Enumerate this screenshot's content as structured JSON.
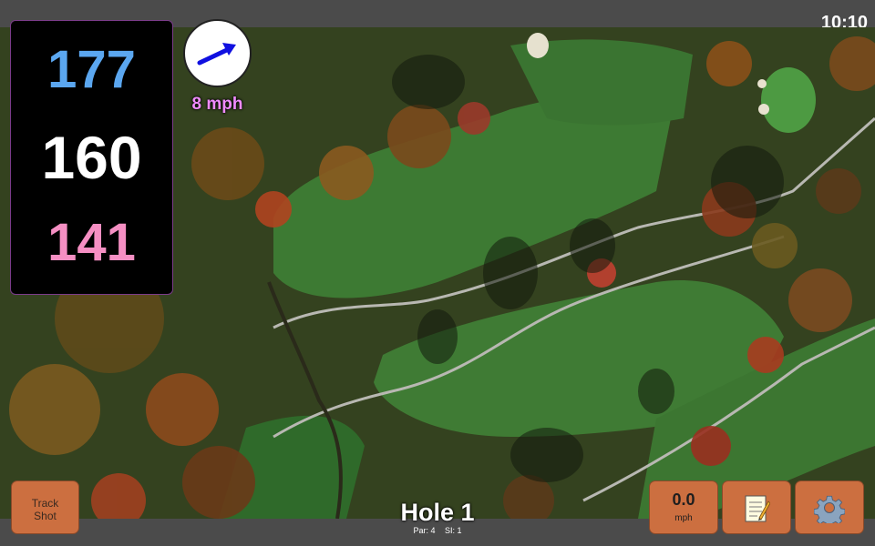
{
  "status_bar": {
    "time": "10:10"
  },
  "distances": {
    "back": "177",
    "center": "160",
    "front": "141"
  },
  "wind": {
    "speed": "8 mph",
    "arrow_icon": "wind-direction-arrow-icon",
    "color": "#1010e0"
  },
  "hole": {
    "title": "Hole 1",
    "par": "Par: 4",
    "stroke_index": "SI: 1"
  },
  "buttons": {
    "track_shot": {
      "line1": "Track",
      "line2": "Shot"
    },
    "speed": {
      "value": "0.0",
      "unit": "mph"
    },
    "notes_icon": "notepad-icon",
    "settings_icon": "gear-icon"
  },
  "colors": {
    "back_distance": "#5ba7f0",
    "center_distance": "#ffffff",
    "front_distance": "#f58fc3",
    "button_accent": "#cc6f40",
    "wind_text": "#f08bff"
  }
}
